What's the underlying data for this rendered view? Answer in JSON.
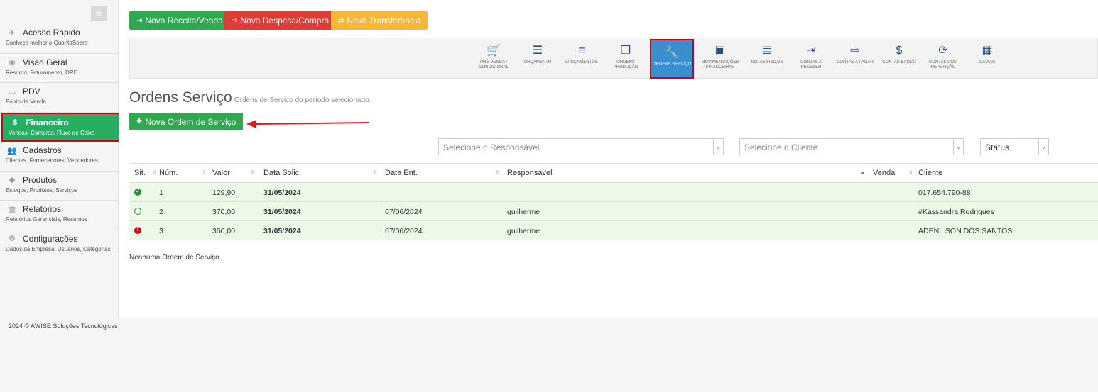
{
  "sidebar": {
    "menu_icon": "hamburger-menu-icon",
    "items": [
      {
        "icon": "rocket-icon",
        "glyph": "✈",
        "title": "Acesso Rápido",
        "subtitle": "Conheça melhor o QuantoSobra"
      },
      {
        "icon": "eye-icon",
        "glyph": "◉",
        "title": "Visão Geral",
        "subtitle": "Resumo, Faturamento, DRE"
      },
      {
        "icon": "monitor-icon",
        "glyph": "▭",
        "title": "PDV",
        "subtitle": "Ponto de Venda"
      },
      {
        "icon": "dollar-icon",
        "glyph": "$",
        "title": "Financeiro",
        "subtitle": "Vendas, Compras, Fluxo de Caixa"
      },
      {
        "icon": "users-icon",
        "glyph": "👥",
        "title": "Cadastros",
        "subtitle": "Clientes, Fornecedores, Vendedores"
      },
      {
        "icon": "tag-icon",
        "glyph": "◆",
        "title": "Produtos",
        "subtitle": "Estoque, Produtos, Serviços"
      },
      {
        "icon": "bar-chart-icon",
        "glyph": "▥",
        "title": "Relatórios",
        "subtitle": "Relatórios Gerenciais, Resumos"
      },
      {
        "icon": "gear-icon",
        "glyph": "⚙",
        "title": "Configurações",
        "subtitle": "Dados da Empresa, Usuários, Categorias"
      }
    ]
  },
  "actions": {
    "nova_receita": "Nova Receita/Venda",
    "nova_despesa": "Nova Despesa/Compra",
    "nova_transferencia": "Nova Transferência"
  },
  "toolbar": [
    {
      "label": "Pré-Venda / Condicional",
      "icon": "cart-icon",
      "glyph": "🛒"
    },
    {
      "label": "Orçamento",
      "icon": "server-icon",
      "glyph": "☰"
    },
    {
      "label": "Lançamentos",
      "icon": "list-icon",
      "glyph": "≡"
    },
    {
      "label": "Ordens Produção",
      "icon": "copy-icon",
      "glyph": "❐"
    },
    {
      "label": "Ordens Serviço",
      "icon": "wrench-icon",
      "glyph": "🔧"
    },
    {
      "label": "Movimentações Financeiras",
      "icon": "money-icon",
      "glyph": "▣"
    },
    {
      "label": "Notas Fiscais",
      "icon": "file-icon",
      "glyph": "▤"
    },
    {
      "label": "Contas a Receber",
      "icon": "sign-in-icon",
      "glyph": "⇥"
    },
    {
      "label": "Contas a Pagar",
      "icon": "sign-out-icon",
      "glyph": "⇨"
    },
    {
      "label": "Contas Banco",
      "icon": "dollar-icon",
      "glyph": "$"
    },
    {
      "label": "Contas com Repetição",
      "icon": "refresh-icon",
      "glyph": "⟳"
    },
    {
      "label": "Caixas",
      "icon": "cash-register-icon",
      "glyph": "▦"
    }
  ],
  "page": {
    "title": "Ordens Serviço",
    "subtitle": "Ordens de Serviço do período selecionado.",
    "new_button": "Nova Ordem de Serviço"
  },
  "filters": {
    "responsavel": "Selecione o Responsável",
    "cliente": "Selecione o Cliente",
    "status": "Status"
  },
  "table": {
    "headers": {
      "sit": "Sit.",
      "num": "Núm.",
      "valor": "Valor",
      "data_solic": "Data Solic.",
      "data_ent": "Data Ent.",
      "responsavel": "Responsável",
      "venda": "Venda",
      "cliente": "Cliente"
    },
    "rows": [
      {
        "status": "ok",
        "num": "1",
        "valor": "129,90",
        "data_solic": "31/05/2024",
        "data_ent": "",
        "responsavel": "",
        "venda": "",
        "cliente": "017.654.790-88"
      },
      {
        "status": "open",
        "num": "2",
        "valor": "370,00",
        "data_solic": "31/05/2024",
        "data_ent": "07/06/2024",
        "responsavel": "guilherme",
        "venda": "",
        "cliente": "#Kassandra Rodrigues"
      },
      {
        "status": "alert",
        "num": "3",
        "valor": "350,00",
        "data_solic": "31/05/2024",
        "data_ent": "07/06/2024",
        "responsavel": "guilherme",
        "venda": "",
        "cliente": "ADENILSON DOS SANTOS"
      }
    ]
  },
  "empty_message": "Nenhuma Ordem de Serviço",
  "footer": "2024 © AWISE Soluções Tecnológicas",
  "colors": {
    "green": "#2fa84f",
    "red": "#dc3d37",
    "orange": "#f6b63c",
    "active_blue": "#3b8fd1",
    "highlight_red": "#d0021b",
    "row_bg": "#ecf9e8"
  }
}
